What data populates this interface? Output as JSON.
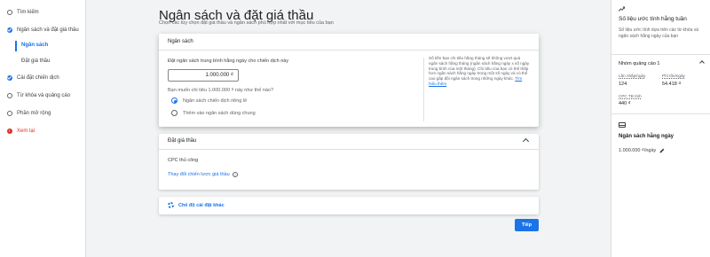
{
  "sidebar": {
    "items": [
      {
        "label": "Tìm kiếm",
        "icon": "search-icon"
      },
      {
        "label": "Ngân sách và đặt giá thầu",
        "icon": "check-circle-icon"
      },
      {
        "label": "Ngân sách"
      },
      {
        "label": "Đặt giá thầu"
      },
      {
        "label": "Cài đặt chiến dịch",
        "icon": "check-circle-icon"
      },
      {
        "label": "Từ khóa và quảng cáo",
        "icon": "circle-icon"
      },
      {
        "label": "Phần mở rộng",
        "icon": "circle-icon"
      },
      {
        "label": "Xem lại",
        "icon": "error-icon"
      }
    ]
  },
  "main": {
    "title": "Ngân sách và đặt giá thầu",
    "subtitle": "Chọn các tùy chọn đặt giá thầu và ngân sách phù hợp nhất với mục tiêu của bạn"
  },
  "budget": {
    "header": "Ngân sách",
    "field_label": "Đặt ngân sách trung bình hằng ngày cho chiến dịch này",
    "value": "1.000.000 ₫",
    "question": "Bạn muốn chi tiêu 1.000.000 ₫ này như thế nào?",
    "options": [
      {
        "label": "Ngân sách chiến dịch riêng lẻ",
        "selected": true
      },
      {
        "label": "Thêm vào ngân sách dùng chung",
        "selected": false
      }
    ],
    "info": "Số tiền bạn chi tiêu hằng tháng sẽ không vượt quá ngân sách hằng tháng (ngân sách hằng ngày x số ngày trung bình của một tháng). Chi tiêu của bạn có thể thấp hơn ngân sách hằng ngày trong một số ngày và có thể cao gấp đôi ngân sách trong những ngày khác. ",
    "info_link": "Tìm hiểu thêm"
  },
  "bidding": {
    "header": "Đặt giá thầu",
    "strategy": "CPC thủ công",
    "change_link": "Thay đổi chiến lược giá thầu"
  },
  "other_settings": {
    "label": "Chế độ cài đặt khác"
  },
  "next_button": "Tiếp",
  "right_panel": {
    "title": "Số liệu ước tính hằng tuần",
    "description": "Số liệu ước tính dựa trên các từ khóa và ngân sách hằng ngày của bạn",
    "group": "Nhóm quảng cáo 1",
    "clicks_label": "Lần nhấp/ngày",
    "clicks_value": "124",
    "cost_label": "Phí tốn/ngày",
    "cost_value": "54.418 ₫",
    "cpc_label": "CPC TB tính",
    "cpc_value": "440 ₫",
    "budget_title": "Ngân sách hằng ngày",
    "budget_value": "1.000.000 ₫/ngày"
  },
  "colors": {
    "accent": "#1a73e8",
    "error": "#d93025"
  }
}
